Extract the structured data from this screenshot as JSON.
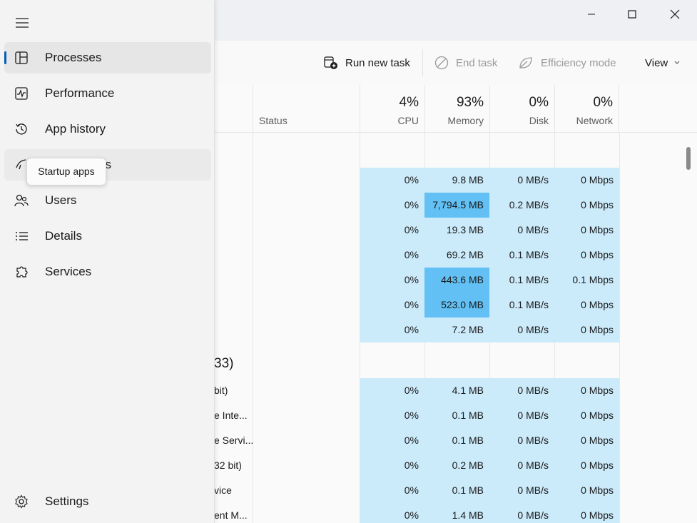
{
  "window": {
    "minimize_label": "─",
    "maximize_label": "☐",
    "close_label": "✕"
  },
  "toolbar": {
    "run_new_task": "Run new task",
    "end_task": "End task",
    "efficiency_mode": "Efficiency mode",
    "view": "View"
  },
  "columns": {
    "status": "Status",
    "cpu_pct": "4%",
    "cpu": "CPU",
    "memory_pct": "93%",
    "memory": "Memory",
    "disk_pct": "0%",
    "disk": "Disk",
    "network_pct": "0%",
    "network": "Network"
  },
  "group1_rows": [
    {
      "cpu": "0%",
      "mem": "9.8 MB",
      "disk": "0 MB/s",
      "net": "0 Mbps"
    },
    {
      "cpu": "0%",
      "mem": "7,794.5 MB",
      "disk": "0.2 MB/s",
      "net": "0 Mbps"
    },
    {
      "cpu": "0%",
      "mem": "19.3 MB",
      "disk": "0 MB/s",
      "net": "0 Mbps"
    },
    {
      "cpu": "0%",
      "mem": "69.2 MB",
      "disk": "0.1 MB/s",
      "net": "0 Mbps"
    },
    {
      "cpu": "0%",
      "mem": "443.6 MB",
      "disk": "0.1 MB/s",
      "net": "0.1 Mbps"
    },
    {
      "cpu": "0%",
      "mem": "523.0 MB",
      "disk": "0.1 MB/s",
      "net": "0 Mbps"
    },
    {
      "cpu": "0%",
      "mem": "7.2 MB",
      "disk": "0 MB/s",
      "net": "0 Mbps"
    }
  ],
  "group2_header": "33)",
  "group2_rows": [
    {
      "name": "bit)",
      "cpu": "0%",
      "mem": "4.1 MB",
      "disk": "0 MB/s",
      "net": "0 Mbps"
    },
    {
      "name": "e Inte...",
      "cpu": "0%",
      "mem": "0.1 MB",
      "disk": "0 MB/s",
      "net": "0 Mbps"
    },
    {
      "name": "e Servi...",
      "cpu": "0%",
      "mem": "0.1 MB",
      "disk": "0 MB/s",
      "net": "0 Mbps"
    },
    {
      "name": "32 bit)",
      "cpu": "0%",
      "mem": "0.2 MB",
      "disk": "0 MB/s",
      "net": "0 Mbps"
    },
    {
      "name": "vice",
      "cpu": "0%",
      "mem": "0.1 MB",
      "disk": "0 MB/s",
      "net": "0 Mbps"
    },
    {
      "name": "ent M...",
      "cpu": "0%",
      "mem": "1.4 MB",
      "disk": "0 MB/s",
      "net": "0 Mbps"
    }
  ],
  "nav": {
    "processes": "Processes",
    "performance": "Performance",
    "app_history": "App history",
    "startup_apps_partial": "os",
    "users": "Users",
    "details": "Details",
    "services": "Services",
    "settings": "Settings"
  },
  "tooltip": "Startup apps",
  "colors": {
    "accent": "#005fb8",
    "cell": "#cbeafa",
    "cell_high": "#62c0f4"
  }
}
